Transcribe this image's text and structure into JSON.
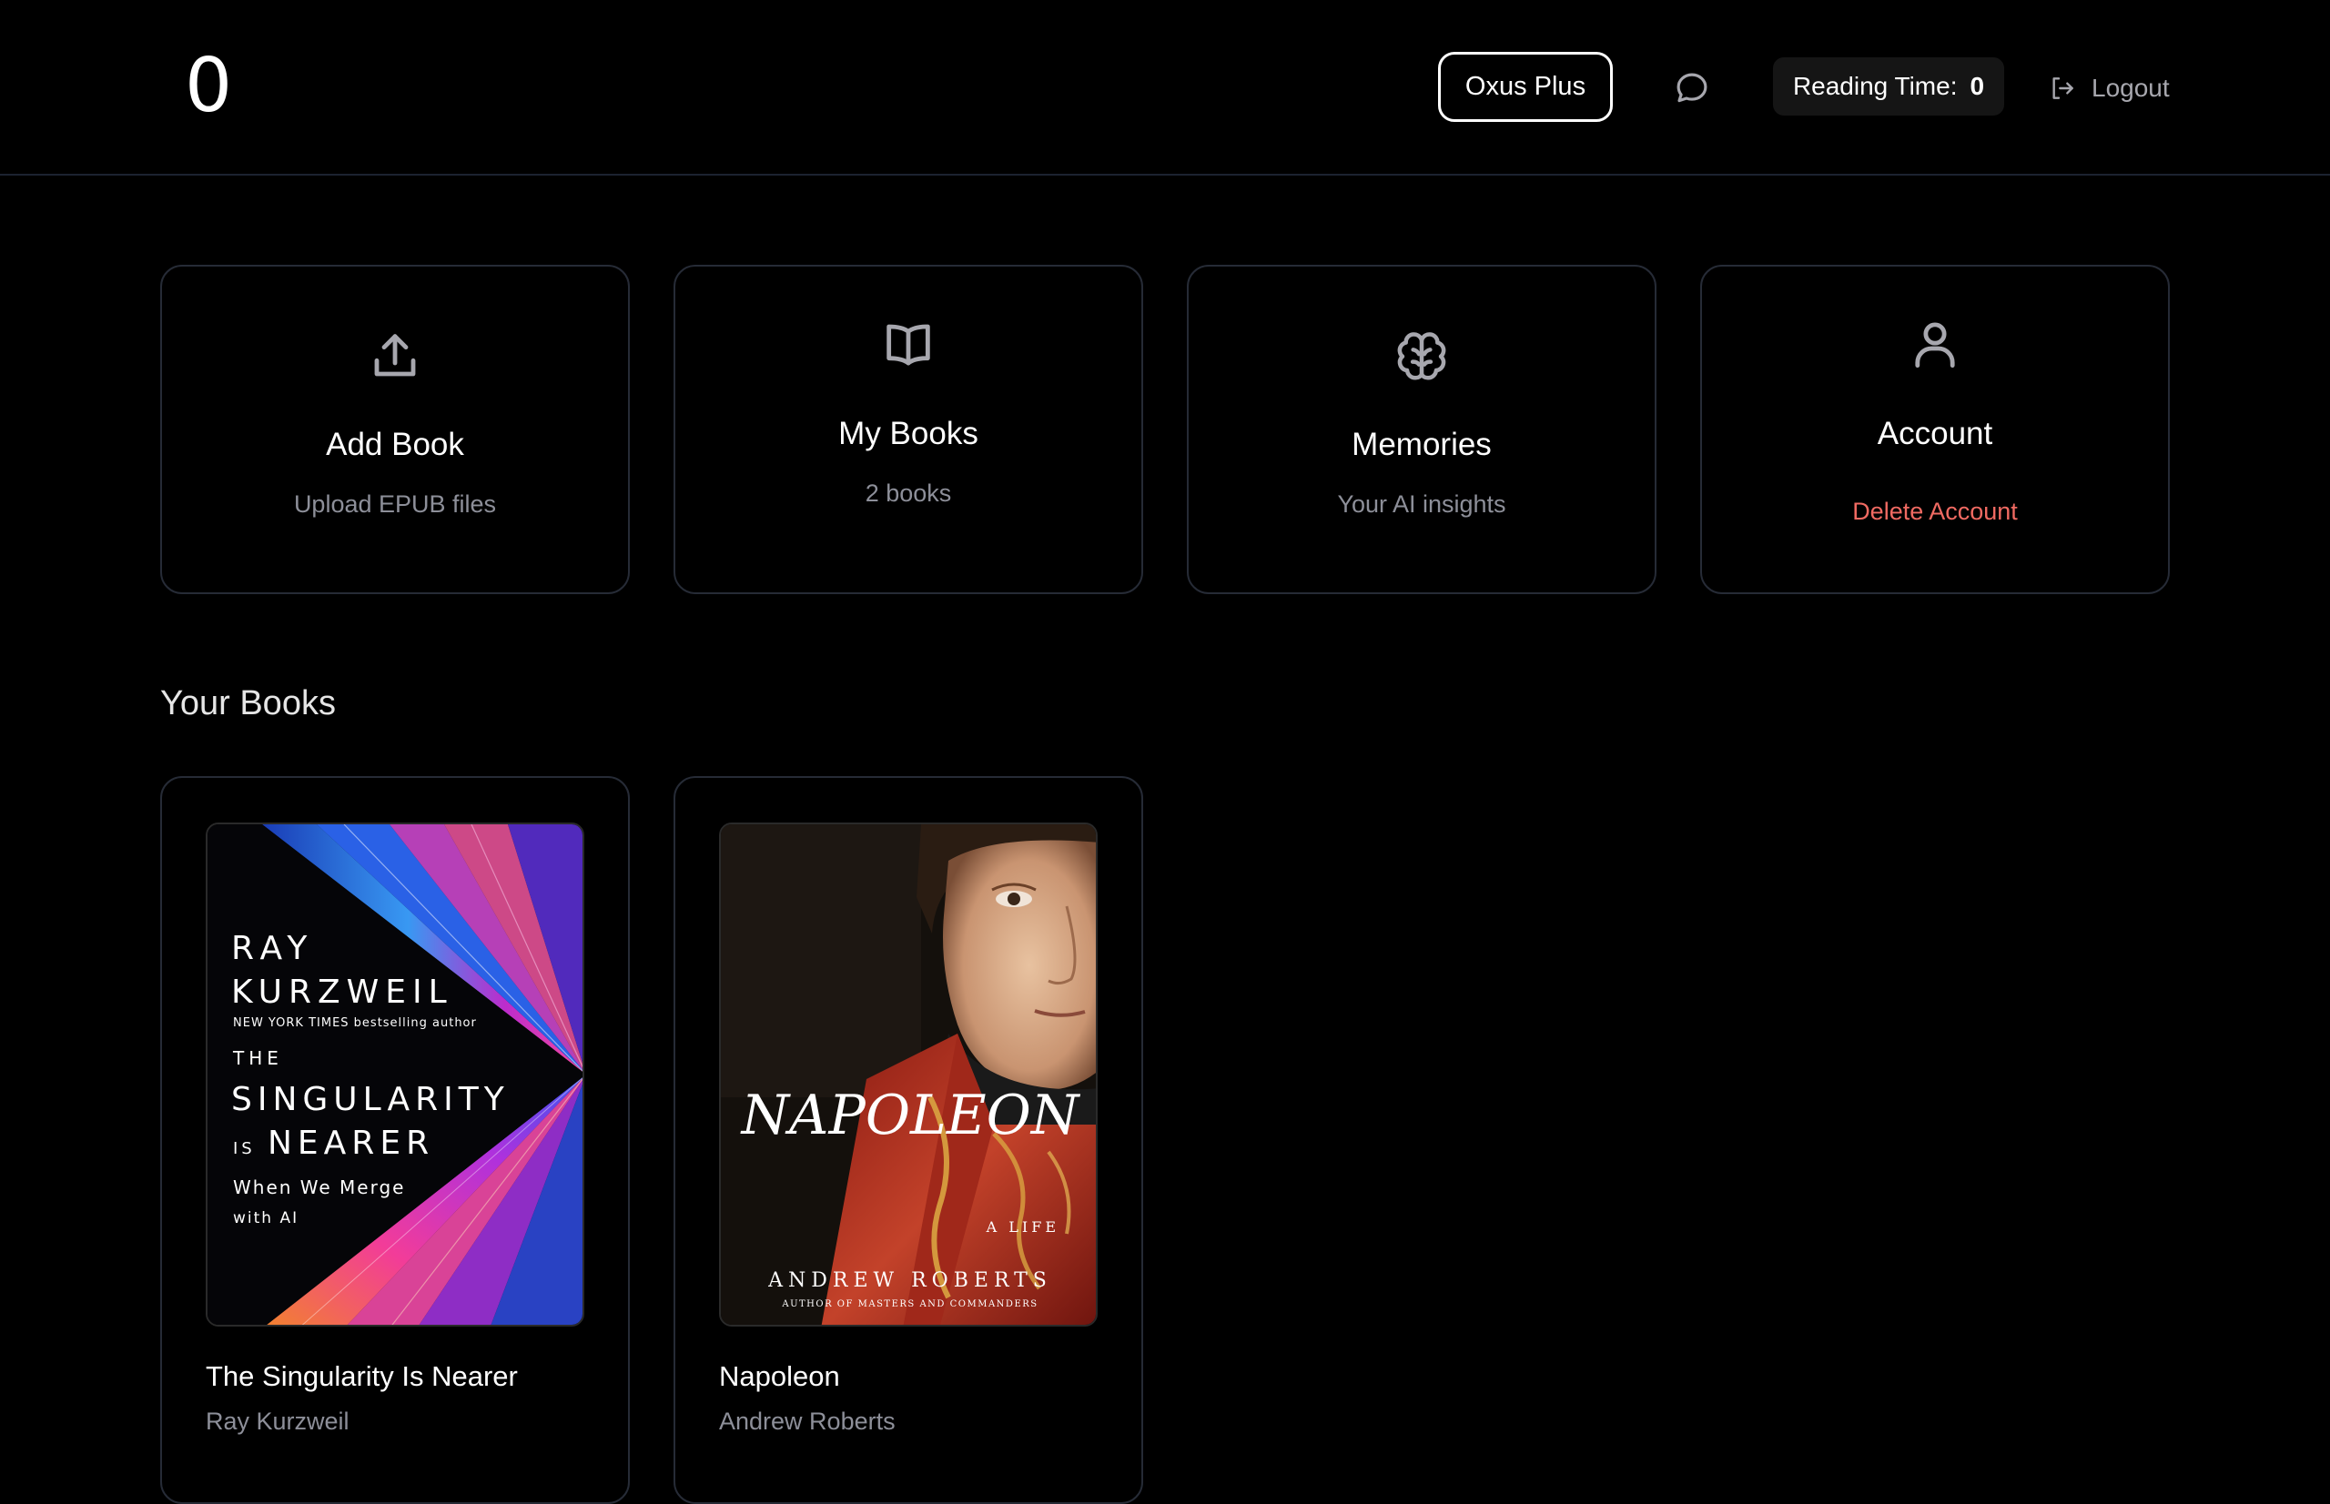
{
  "header": {
    "logo": "0",
    "plus_label": "Oxus Plus",
    "reading_time_label": "Reading Time:",
    "reading_time_value": "0",
    "logout_label": "Logout"
  },
  "cards": [
    {
      "title": "Add Book",
      "subtitle": "Upload EPUB files",
      "icon": "upload-icon"
    },
    {
      "title": "My Books",
      "subtitle": "2 books",
      "icon": "book-open-icon"
    },
    {
      "title": "Memories",
      "subtitle": "Your AI insights",
      "icon": "brain-icon"
    },
    {
      "title": "Account",
      "subtitle": "Delete Account",
      "icon": "user-icon"
    }
  ],
  "section_title": "Your Books",
  "books": [
    {
      "title": "The Singularity Is Nearer",
      "author": "Ray Kurzweil",
      "cover": {
        "author_line1": "RAY",
        "author_line2": "KURZWEIL",
        "tagline": "NEW YORK TIMES bestselling author",
        "the": "THE",
        "title1": "SINGULARITY",
        "is": "IS",
        "title2": "NEARER",
        "sub1": "When We Merge",
        "sub2": "with AI"
      }
    },
    {
      "title": "Napoleon",
      "author": "Andrew Roberts",
      "cover": {
        "title": "NAPOLEON",
        "sub": "A LIFE",
        "author": "ANDREW ROBERTS",
        "tagline": "AUTHOR OF MASTERS AND COMMANDERS"
      }
    }
  ],
  "colors": {
    "background": "#000000",
    "card_border": "#262b36",
    "muted_text": "#8d8f99",
    "danger": "#f06a62"
  }
}
